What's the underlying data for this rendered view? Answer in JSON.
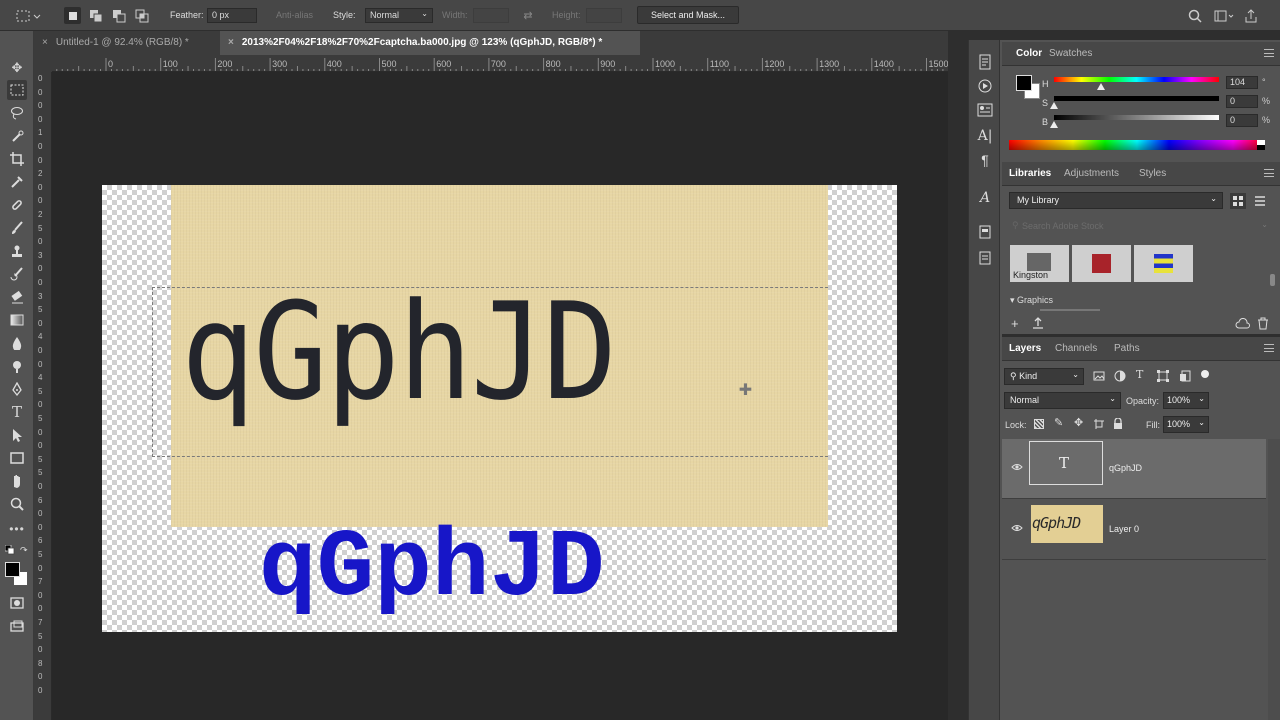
{
  "options": {
    "feather_label": "Feather:",
    "feather_value": "0 px",
    "antialias_label": "Anti-alias",
    "style_label": "Style:",
    "style_value": "Normal",
    "width_label": "Width:",
    "height_label": "Height:",
    "select_mask_label": "Select and Mask..."
  },
  "tabs": [
    {
      "label": "Untitled-1 @ 92.4% (RGB/8) *",
      "active": false
    },
    {
      "label": "2013%2F04%2F18%2F70%2Fcaptcha.ba000.jpg @ 123% (qGphJD, RGB/8*) *",
      "active": true
    }
  ],
  "ruler": {
    "h_ticks": [
      "0",
      "100",
      "200",
      "300",
      "400",
      "500",
      "600",
      "700",
      "800",
      "900",
      "1000",
      "1100",
      "1200",
      "1300",
      "1400",
      "1500"
    ],
    "v_ticks": [
      "0",
      "0",
      "0",
      "0",
      "1",
      "0",
      "0",
      "2",
      "0",
      "0",
      "2",
      "5",
      "0",
      "3",
      "0",
      "0",
      "3",
      "5",
      "0",
      "4",
      "0",
      "0",
      "4",
      "5",
      "0",
      "5",
      "0",
      "0",
      "5",
      "5",
      "0",
      "6",
      "0",
      "0",
      "6",
      "5",
      "0",
      "7",
      "0",
      "0",
      "7",
      "5",
      "0",
      "8",
      "0",
      "0"
    ]
  },
  "canvas": {
    "captcha_text": "qGphJD",
    "layer_text": "qGphJD",
    "layer_text_color": "#1716c8"
  },
  "color_panel": {
    "tabs": [
      "Color",
      "Swatches"
    ],
    "h_label": "H",
    "h_value": "104",
    "h_unit": "°",
    "s_label": "S",
    "s_value": "0",
    "s_unit": "%",
    "b_label": "B",
    "b_value": "0",
    "b_unit": "%",
    "foreground": "#000000",
    "background": "#ffffff"
  },
  "libraries_panel": {
    "tabs": [
      "Libraries",
      "Adjustments",
      "Styles"
    ],
    "library_name": "My Library",
    "search_placeholder": "Search Adobe Stock",
    "swatch_items": [
      {
        "label": "Kingston"
      },
      {
        "label": ""
      },
      {
        "label": ""
      }
    ],
    "graphics_label": "Graphics"
  },
  "layers_panel": {
    "tabs": [
      "Layers",
      "Channels",
      "Paths"
    ],
    "filter_kind": "Kind",
    "blend_mode": "Normal",
    "opacity_label": "Opacity:",
    "opacity_value": "100%",
    "lock_label": "Lock:",
    "fill_label": "Fill:",
    "fill_value": "100%",
    "layers": [
      {
        "name": "qGphJD",
        "type": "text",
        "selected": true,
        "thumb_glyph": "T"
      },
      {
        "name": "Layer 0",
        "type": "image",
        "selected": false,
        "thumb_text": "qGphJD"
      }
    ]
  }
}
